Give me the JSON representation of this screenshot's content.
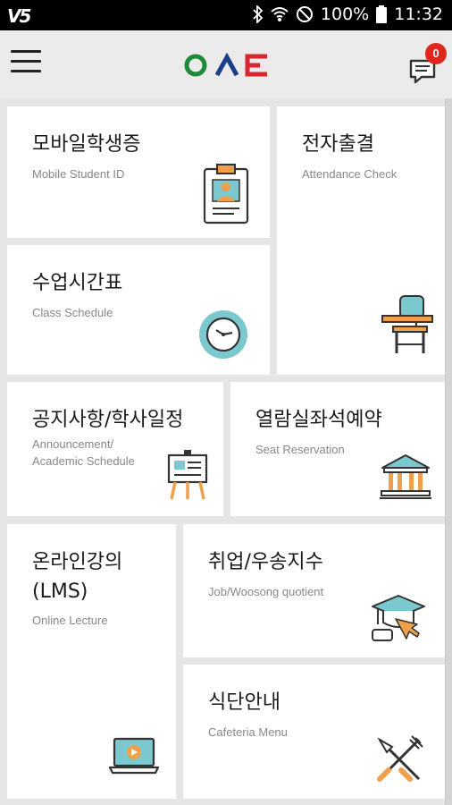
{
  "status_bar": {
    "carrier_glyph": "V5",
    "battery_text": "100%",
    "time": "11:32",
    "icons": [
      "bluetooth-icon",
      "wifi-icon",
      "no-sim-icon",
      "battery-icon"
    ]
  },
  "header": {
    "menu_icon": "hamburger-menu-icon",
    "logo_icon": "woosong-logo-icon",
    "message_icon": "chat-bubble-icon",
    "notification_count": "0",
    "badge_color": "#e0261c"
  },
  "tiles": [
    {
      "ko": "모바일학생증",
      "en": "Mobile Student ID",
      "icon": "id-card-icon"
    },
    {
      "ko": "전자출결",
      "en": "Attendance Check",
      "icon": "school-desk-icon"
    },
    {
      "ko": "수업시간표",
      "en": "Class Schedule",
      "icon": "clock-icon"
    },
    {
      "ko": "공지사항/학사일정",
      "en_line1": "Announcement/",
      "en_line2": "Academic Schedule",
      "icon": "easel-board-icon"
    },
    {
      "ko": "열람실좌석예약",
      "en": "Seat Reservation",
      "icon": "library-building-icon"
    },
    {
      "ko_line1": "온라인강의",
      "ko_line2": "(LMS)",
      "en": "Online Lecture",
      "icon": "laptop-play-icon"
    },
    {
      "ko": "취업/우송지수",
      "en": "Job/Woosong quotient",
      "icon": "graduation-cap-icon"
    },
    {
      "ko": "식단안내",
      "en": "Cafeteria Menu",
      "icon": "fork-knife-icon"
    }
  ],
  "colors": {
    "accent_teal": "#7cc8cf",
    "logo_green": "#1e8a3c",
    "logo_blue": "#1a3e8a",
    "logo_red": "#d7262d"
  }
}
